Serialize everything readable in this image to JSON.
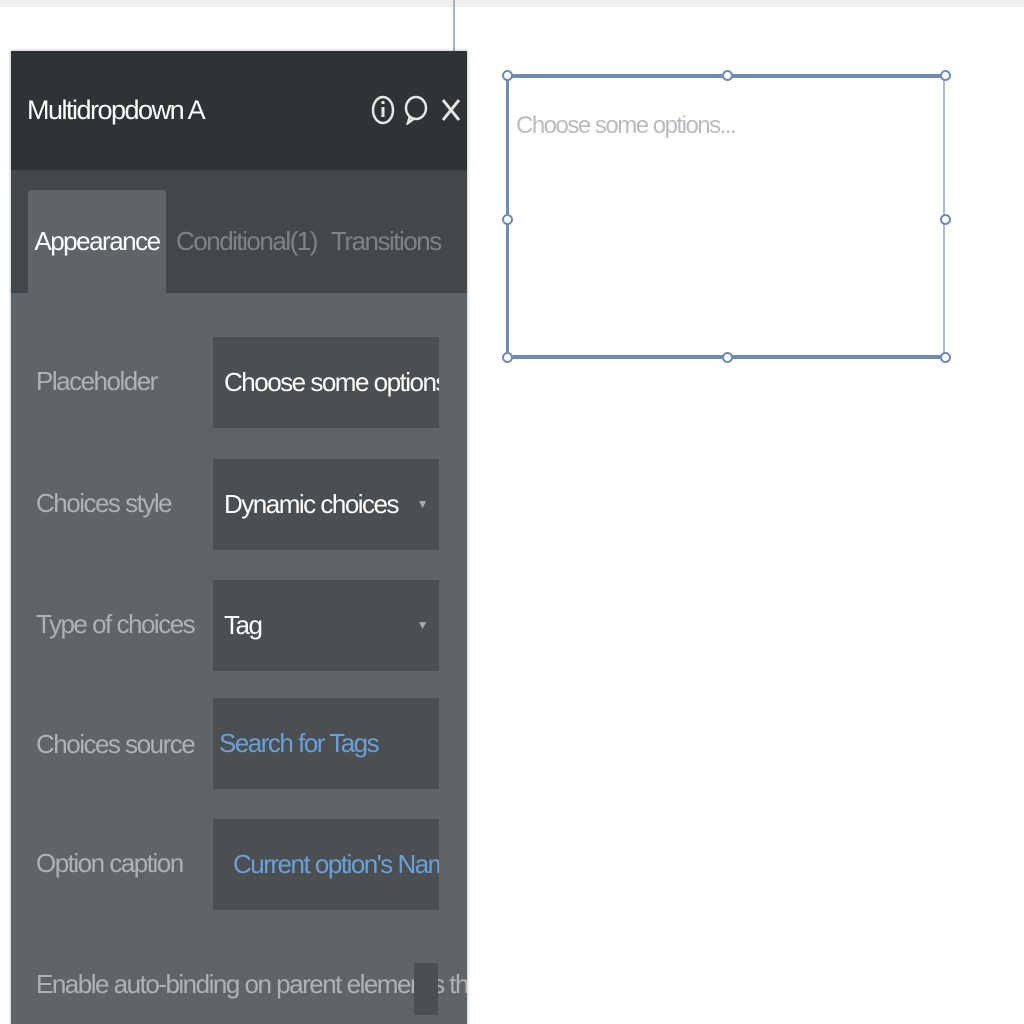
{
  "panel": {
    "title": "Multidropdown A",
    "icons": [
      "info-icon",
      "comment-icon",
      "close-icon"
    ],
    "tabs": [
      {
        "label": "Appearance",
        "active": true
      },
      {
        "label": "Conditional(1)",
        "active": false
      },
      {
        "label": "Transitions",
        "active": false
      }
    ],
    "properties": {
      "placeholder": {
        "label": "Placeholder",
        "value": "Choose some options..."
      },
      "choices_style": {
        "label": "Choices style",
        "value": "Dynamic choices"
      },
      "type_of_choices": {
        "label": "Type of choices",
        "value": "Tag"
      },
      "choices_source": {
        "label": "Choices source",
        "value": "Search for Tags"
      },
      "option_caption": {
        "label": "Option caption",
        "value": "Current option's Name"
      }
    },
    "auto_binding": {
      "label": "Enable auto-binding on parent element's thing",
      "checked": false
    }
  },
  "canvas": {
    "element_placeholder": "Choose some options..."
  },
  "colors": {
    "panel_bg": "#5f6468",
    "header_bg": "#2e3336",
    "dynamic_text": "#6aa0d8",
    "selection": "#6f8bb2"
  }
}
